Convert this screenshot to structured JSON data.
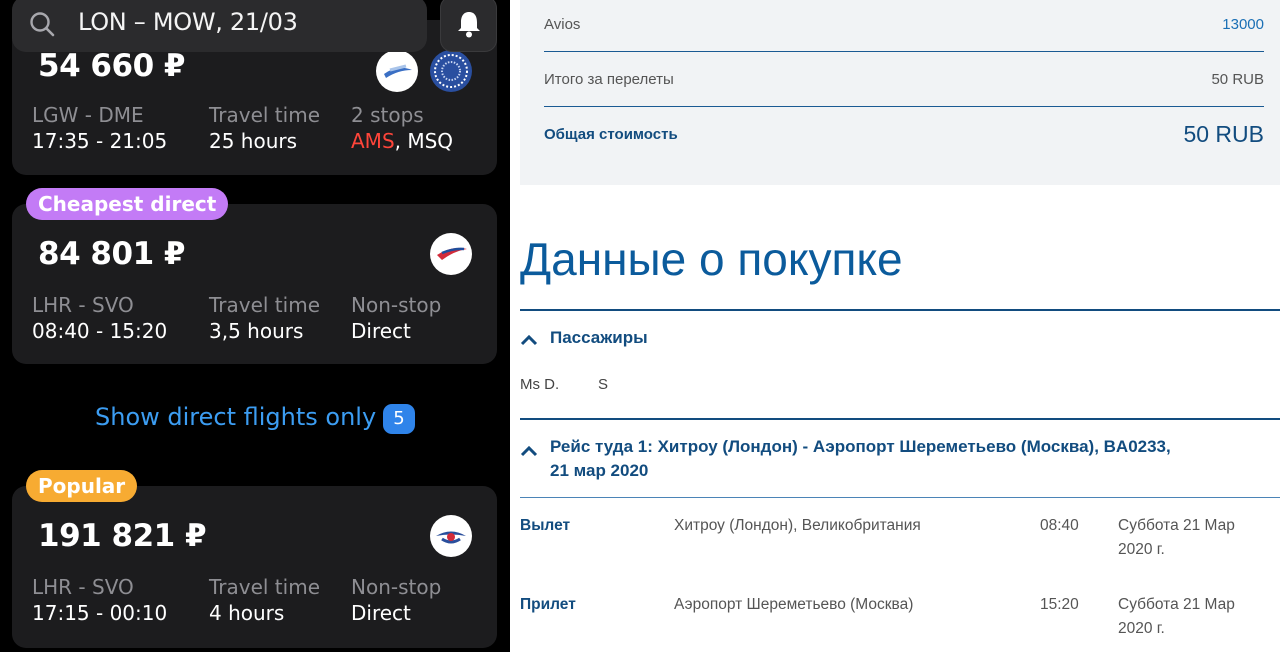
{
  "app": {
    "search_text": "LON – MOW, 21/03",
    "accent_blue": "#3c9df2",
    "badge_purple": "#c37bf6",
    "badge_orange": "#f7ab32",
    "stop_highlight": "#ff453a"
  },
  "cards": [
    {
      "price": "54 660 ₽",
      "route": "LGW - DME",
      "times": "17:35 - 21:05",
      "travel_label": "Travel time",
      "travel_value": "25 hours",
      "stops_label": "2 stops",
      "stops_highlight": "AMS",
      "stops_rest": ", MSQ"
    },
    {
      "badge": "Cheapest direct",
      "price": "84 801 ₽",
      "route": "LHR - SVO",
      "times": "08:40 - 15:20",
      "travel_label": "Travel time",
      "travel_value": "3,5 hours",
      "stops_label": "Non-stop",
      "stops_value": "Direct"
    },
    {
      "badge": "Popular",
      "price": "191 821 ₽",
      "route": "LHR - SVO",
      "times": "17:15 - 00:10",
      "travel_label": "Travel time",
      "travel_value": "4 hours",
      "stops_label": "Non-stop",
      "stops_value": "Direct"
    }
  ],
  "show_direct": {
    "label": "Show direct flights only",
    "count": "5"
  },
  "booking": {
    "summary": [
      {
        "label": "Avios",
        "value": "13000"
      },
      {
        "label": "Итого за перелеты",
        "value": "50 RUB"
      },
      {
        "label": "Общая стоимость",
        "value": "50 RUB"
      }
    ],
    "section_title": "Данные о покупке",
    "passengers_heading": "Пассажиры",
    "passenger_name": "Ms D.",
    "passenger_surname": "S",
    "flight_heading_line1": "Рейс туда 1: Хитроу (Лондон) - Аэропорт Шереметьево (Москва), BA0233,",
    "flight_heading_line2": "21 мар 2020",
    "rows": [
      {
        "label": "Вылет",
        "place": "Хитроу (Лондон), Великобритания",
        "time": "08:40",
        "date_line1": "Суббота 21 Мар",
        "date_line2": "2020 г."
      },
      {
        "label": "Прилет",
        "place": "Аэропорт Шереметьево (Москва)",
        "time": "15:20",
        "date_line1": "Суббота 21 Мар",
        "date_line2": "2020 г."
      }
    ]
  }
}
